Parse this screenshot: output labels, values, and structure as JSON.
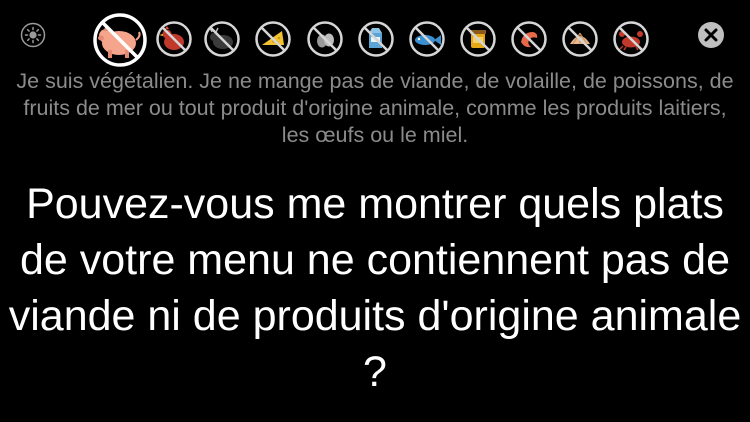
{
  "toolbar": {
    "brightness_icon": "sun-icon",
    "close_icon": "close-icon",
    "foods": [
      {
        "name": "pork",
        "icon": "pig-icon",
        "selected": true,
        "color": "#f4a58c"
      },
      {
        "name": "poultry",
        "icon": "chicken-icon",
        "selected": false,
        "color": "#c0392b"
      },
      {
        "name": "beef",
        "icon": "cow-icon",
        "selected": false,
        "color": "#444444"
      },
      {
        "name": "cheese",
        "icon": "cheese-icon",
        "selected": false,
        "color": "#f2c230"
      },
      {
        "name": "eggs",
        "icon": "egg-icon",
        "selected": false,
        "color": "#9a9a9a"
      },
      {
        "name": "milk",
        "icon": "milk-carton-icon",
        "selected": false,
        "color": "#5da4d6"
      },
      {
        "name": "fish",
        "icon": "fish-icon",
        "selected": false,
        "color": "#3b8fd0"
      },
      {
        "name": "honey",
        "icon": "honey-jar-icon",
        "selected": false,
        "color": "#e6a817"
      },
      {
        "name": "shrimp",
        "icon": "shrimp-icon",
        "selected": false,
        "color": "#e8684a"
      },
      {
        "name": "shellfish",
        "icon": "clam-icon",
        "selected": false,
        "color": "#e9b98c"
      },
      {
        "name": "crab",
        "icon": "crab-icon",
        "selected": false,
        "color": "#c0392b"
      }
    ]
  },
  "statement": "Je suis végétalien. Je ne mange pas de viande, de volaille, de poissons, de fruits de mer ou tout produit d'origine animale, comme les produits laitiers, les œufs ou le miel.",
  "question": "Pouvez-vous me montrer quels plats de votre menu ne contiennent pas de viande ni de produits d'origine animale ?",
  "colors": {
    "background": "#000000",
    "statement_text": "#8b8b8b",
    "question_text": "#ffffff",
    "icon_circle": "#d6d6d6"
  }
}
